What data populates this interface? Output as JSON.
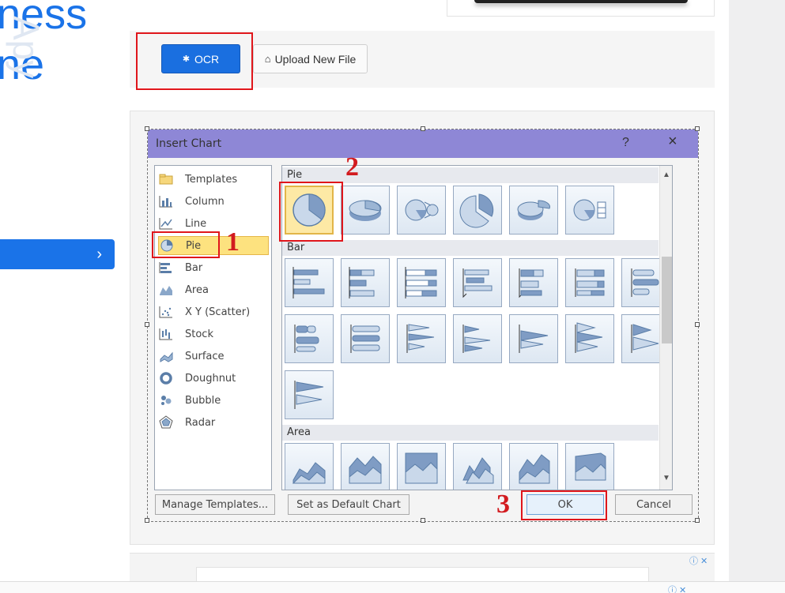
{
  "hero": {
    "line1": "ness",
    "line2": "ne",
    "watermark": "Apy"
  },
  "nav": {
    "chevron": "›"
  },
  "toolbar": {
    "ocr_label": "OCR",
    "ocr_icon": "gear-icon",
    "upload_label": "Upload New File",
    "upload_icon": "home-icon"
  },
  "dialog": {
    "title": "Insert Chart",
    "help": "?",
    "close": "×",
    "chart_types": [
      {
        "label": "Templates",
        "icon": "folder-icon"
      },
      {
        "label": "Column",
        "icon": "column-chart-icon"
      },
      {
        "label": "Line",
        "icon": "line-chart-icon"
      },
      {
        "label": "Pie",
        "icon": "pie-chart-icon"
      },
      {
        "label": "Bar",
        "icon": "bar-chart-icon"
      },
      {
        "label": "Area",
        "icon": "area-chart-icon"
      },
      {
        "label": "X Y (Scatter)",
        "icon": "scatter-chart-icon"
      },
      {
        "label": "Stock",
        "icon": "stock-chart-icon"
      },
      {
        "label": "Surface",
        "icon": "surface-chart-icon"
      },
      {
        "label": "Doughnut",
        "icon": "doughnut-chart-icon"
      },
      {
        "label": "Bubble",
        "icon": "bubble-chart-icon"
      },
      {
        "label": "Radar",
        "icon": "radar-chart-icon"
      }
    ],
    "selected_type": "Pie",
    "sections": {
      "pie": "Pie",
      "bar": "Bar",
      "area": "Area"
    },
    "buttons": {
      "manage": "Manage Templates...",
      "set_default": "Set as Default Chart",
      "ok": "OK",
      "cancel": "Cancel"
    }
  },
  "steps": {
    "one": "1",
    "two": "2",
    "three": "3"
  },
  "ad": {
    "choices": "ⓘ ✕"
  },
  "colors": {
    "accent": "#1a6fe0",
    "annotation": "#e0161b",
    "dialog_title": "#8e87d6",
    "selection": "#fde27f"
  }
}
